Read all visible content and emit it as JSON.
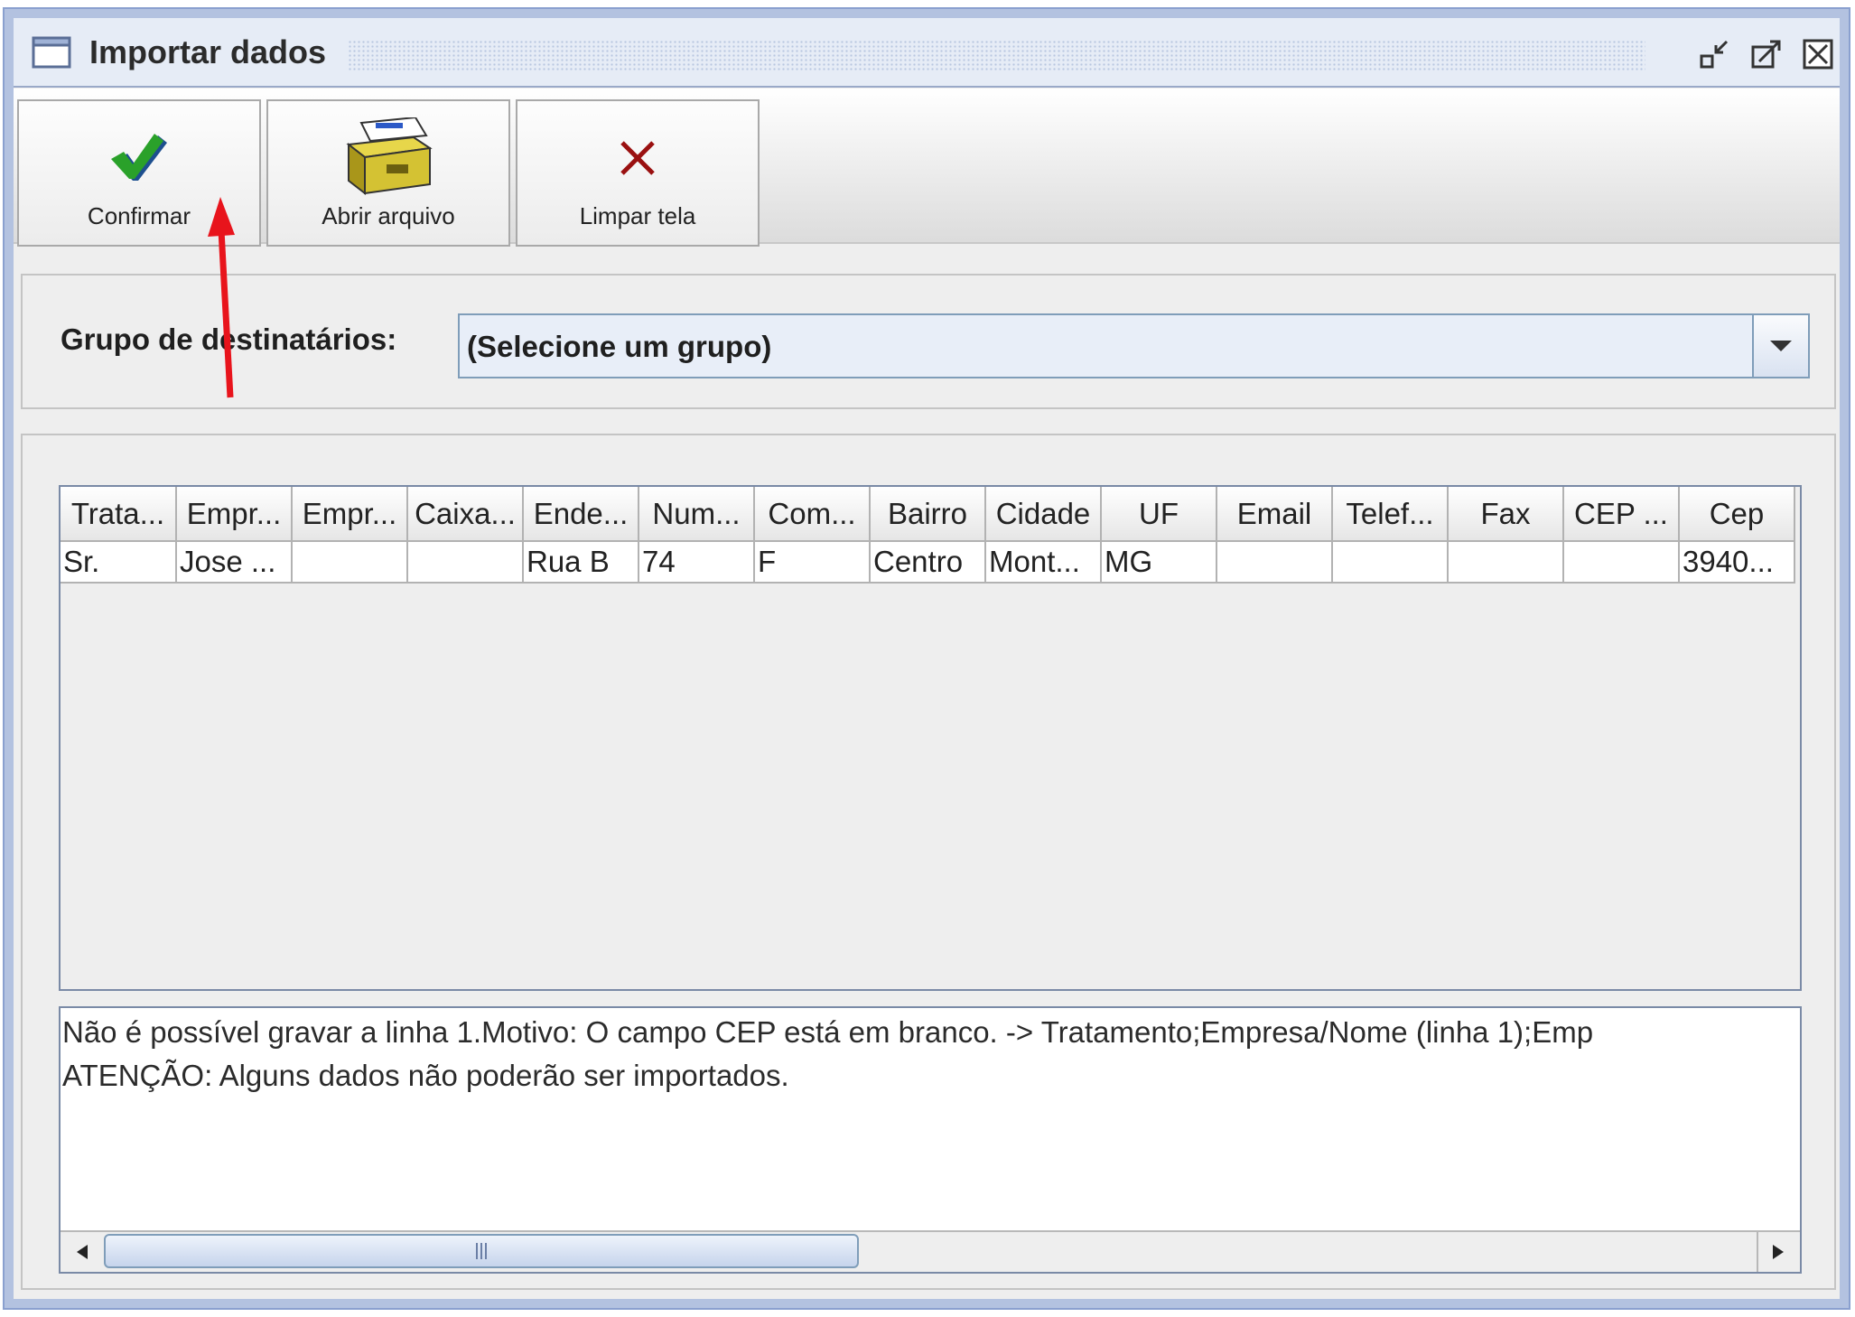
{
  "window": {
    "title": "Importar dados"
  },
  "toolbar": {
    "confirm_label": "Confirmar",
    "open_label": "Abrir arquivo",
    "clear_label": "Limpar tela"
  },
  "group": {
    "label": "Grupo de destinatários:",
    "selected": "(Selecione um grupo)"
  },
  "table": {
    "headers": [
      "Trata...",
      "Empr...",
      "Empr...",
      "Caixa...",
      "Ende...",
      "Num...",
      "Com...",
      "Bairro",
      "Cidade",
      "UF",
      "Email",
      "Telef...",
      "Fax",
      "CEP ...",
      "Cep"
    ],
    "rows": [
      [
        "Sr.",
        "Jose ...",
        "",
        "",
        "Rua B",
        "74",
        "F",
        "Centro",
        "Mont...",
        "MG",
        "",
        "",
        "",
        "",
        "3940..."
      ]
    ]
  },
  "messages": {
    "line1": "Não é possível gravar a linha 1.Motivo: O campo CEP está em branco. ->  Tratamento;Empresa/Nome (linha 1);Emp",
    "line2": "ATENÇÃO: Alguns dados não poderão ser importados."
  },
  "colors": {
    "window_border": "#b3c2e0",
    "annotation_arrow": "#e8141c",
    "confirm_check": "#1c8a1c",
    "clear_x": "#9a1010"
  },
  "icons": {
    "window": "window-icon",
    "minimize": "minimize-icon",
    "maximize": "maximize-icon",
    "close": "close-icon",
    "confirm": "checkmark-icon",
    "open": "file-drawer-icon",
    "clear": "x-icon",
    "dropdown": "chevron-down-icon"
  }
}
